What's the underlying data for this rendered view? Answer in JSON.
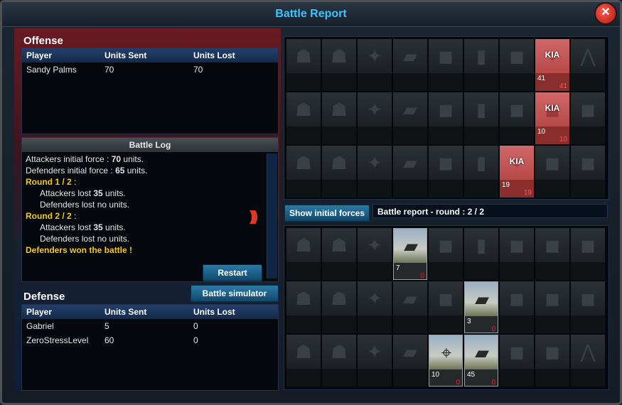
{
  "window": {
    "title": "Battle Report"
  },
  "offense": {
    "title": "Offense",
    "columns": [
      "Player",
      "Units Sent",
      "Units Lost"
    ],
    "rows": [
      {
        "player": "Sandy Palms",
        "sent": "70",
        "lost": "70"
      }
    ]
  },
  "battle_log": {
    "title": "Battle Log",
    "lines": {
      "att_initial_prefix": "Attackers initial force : ",
      "att_initial_value": "70",
      "att_initial_suffix": " units.",
      "def_initial_prefix": "Defenders initial force : ",
      "def_initial_value": "65",
      "def_initial_suffix": " units.",
      "round1": "Round 1 / 2",
      "round1_colon": " :",
      "r1_att_prefix": "Attackers lost ",
      "r1_att_value": "35",
      "r1_att_suffix": " units.",
      "r1_def": "Defenders lost no units.",
      "round2": "Round 2 / 2",
      "round2_colon": " :",
      "r2_att_prefix": "Attackers lost ",
      "r2_att_value": "35",
      "r2_att_suffix": " units.",
      "r2_def": "Defenders lost no units.",
      "result": "Defenders won the battle !"
    },
    "restart_label": "Restart"
  },
  "simulator_label": "Battle simulator",
  "defense": {
    "title": "Defense",
    "columns": [
      "Player",
      "Units Sent",
      "Units Lost"
    ],
    "rows": [
      {
        "player": "Gabriel",
        "sent": "5",
        "lost": "0"
      },
      {
        "player": "ZeroStressLevel",
        "sent": "60",
        "lost": "0"
      }
    ]
  },
  "show_initial_label": "Show initial forces",
  "round_label": "Battle report - round : 2 / 2",
  "attacker_grid": [
    [
      {
        "s": "infantry"
      },
      {
        "s": "infantry"
      },
      {
        "s": "bazooka"
      },
      {
        "s": "jeep"
      },
      {
        "s": "tank"
      },
      {
        "s": "truck"
      },
      {
        "s": "tank"
      },
      {
        "s": "aa",
        "kia": "KIA",
        "count": "41",
        "lost": "41"
      },
      {
        "s": "artillery"
      }
    ],
    [
      {
        "s": "infantry"
      },
      {
        "s": "infantry"
      },
      {
        "s": "bazooka"
      },
      {
        "s": "jeep"
      },
      {
        "s": "tank"
      },
      {
        "s": "truck"
      },
      {
        "s": "tank"
      },
      {
        "s": "tank",
        "kia": "KIA",
        "count": "10",
        "lost": "10"
      },
      {
        "s": "tank"
      }
    ],
    [
      {
        "s": "infantry"
      },
      {
        "s": "infantry"
      },
      {
        "s": "bazooka"
      },
      {
        "s": "jeep"
      },
      {
        "s": "tank"
      },
      {
        "s": "truck",
        "kia_cell": true
      },
      {
        "s": "aa",
        "kia": "KIA",
        "count": "19",
        "lost": "19"
      },
      {
        "s": "tank"
      },
      {
        "s": "tank"
      }
    ]
  ],
  "defender_grid": [
    [
      {
        "s": "infantry"
      },
      {
        "s": "infantry"
      },
      {
        "s": "bazooka"
      },
      {
        "s": "humvee",
        "active": true,
        "count": "7",
        "lost": "0"
      },
      {
        "s": "tank"
      },
      {
        "s": "truck"
      },
      {
        "s": "tank"
      },
      {
        "s": "tank"
      },
      {
        "s": "tank"
      }
    ],
    [
      {
        "s": "infantry"
      },
      {
        "s": "infantry"
      },
      {
        "s": "bazooka"
      },
      {
        "s": "jeep"
      },
      {
        "s": "tank"
      },
      {
        "s": "humvee",
        "active": true,
        "count": "3",
        "lost": "0"
      },
      {
        "s": "tank"
      },
      {
        "s": "tank"
      },
      {
        "s": "tank"
      }
    ],
    [
      {
        "s": "infantry"
      },
      {
        "s": "infantry"
      },
      {
        "s": "bazooka"
      },
      {
        "s": "jeep"
      },
      {
        "s": "aa",
        "active": true,
        "count": "10",
        "lost": "0"
      },
      {
        "s": "humvee",
        "active": true,
        "count": "45",
        "lost": "0"
      },
      {
        "s": "tank"
      },
      {
        "s": "tank"
      },
      {
        "s": "artillery"
      }
    ]
  ],
  "icons": {
    "close": "close-icon",
    "sound": "sound-wave-icon"
  }
}
